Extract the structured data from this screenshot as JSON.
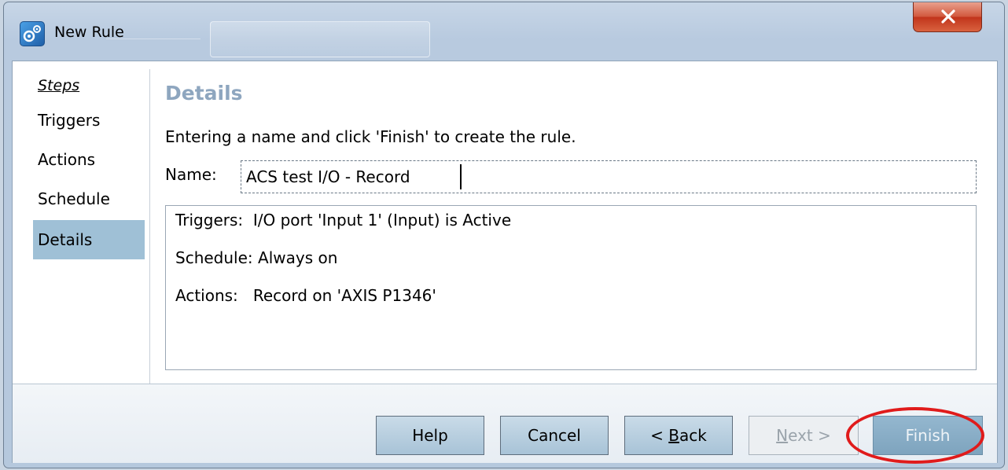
{
  "window": {
    "title": "New Rule",
    "icon": "rule-gear-icon",
    "close_icon": "close-icon"
  },
  "steps": {
    "heading": "Steps",
    "items": [
      {
        "label": "Triggers",
        "active": false
      },
      {
        "label": "Actions",
        "active": false
      },
      {
        "label": "Schedule",
        "active": false
      },
      {
        "label": "Details",
        "active": true
      }
    ]
  },
  "details": {
    "title": "Details",
    "instructions": "Entering a name and click 'Finish' to create the rule.",
    "name_label": "Name:",
    "name_value": "ACS test I/O - Record"
  },
  "summary": {
    "rows": [
      {
        "label": "Triggers:",
        "value": "I/O port 'Input 1' (Input) is Active"
      },
      {
        "label": "Schedule:",
        "value": "Always on"
      },
      {
        "label": "Actions:",
        "value": "Record on 'AXIS P1346'"
      }
    ]
  },
  "buttons": {
    "help": "Help",
    "cancel": "Cancel",
    "back_prefix": "< ",
    "back_mnemonic": "B",
    "back_rest": "ack",
    "next_mnemonic": "N",
    "next_rest": "ext >",
    "finish": "Finish"
  },
  "colors": {
    "accent_title": "#8ea6bf",
    "active_step": "#9fc0d6",
    "highlight": "#e01b1b"
  }
}
